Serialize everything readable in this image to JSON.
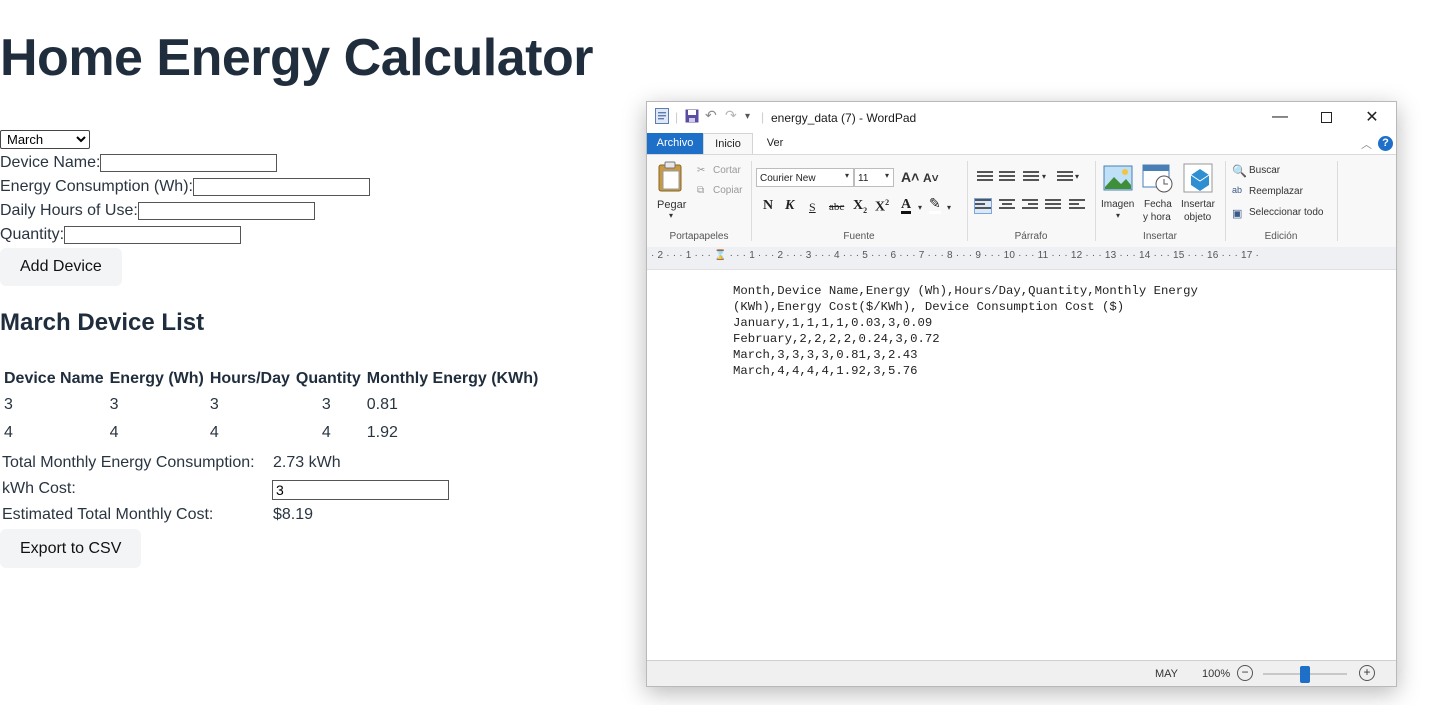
{
  "app": {
    "title": "Home Energy Calculator",
    "month_selected": "March",
    "form": {
      "device_name_label": "Device Name:",
      "energy_label": "Energy Consumption (Wh):",
      "hours_label": "Daily Hours of Use:",
      "quantity_label": "Quantity:",
      "device_name_value": "",
      "energy_value": "",
      "hours_value": "",
      "quantity_value": ""
    },
    "add_button": "Add Device",
    "list_title": "March Device List",
    "table": {
      "headers": [
        "Device Name",
        "Energy (Wh)",
        "Hours/Day",
        "Quantity",
        "Monthly Energy (KWh)"
      ],
      "rows": [
        [
          "3",
          "3",
          "3",
          "3",
          "0.81"
        ],
        [
          "4",
          "4",
          "4",
          "4",
          "1.92"
        ]
      ]
    },
    "summary": {
      "total_label": "Total Monthly Energy Consumption:",
      "total_value": "2.73 kWh",
      "cost_label": "kWh Cost:",
      "cost_value": "3",
      "estimate_label": "Estimated Total Monthly Cost:",
      "estimate_value": "$8.19"
    },
    "export_button": "Export to CSV"
  },
  "wordpad": {
    "title": "energy_data (7) - WordPad",
    "tabs": [
      "Archivo",
      "Inicio",
      "Ver"
    ],
    "clipboard": {
      "paste": "Pegar",
      "cut": "Cortar",
      "copy": "Copiar",
      "group": "Portapapeles"
    },
    "font": {
      "name": "Courier New",
      "size": "11",
      "group": "Fuente"
    },
    "paragraph_group": "Párrafo",
    "insert": {
      "image": "Imagen",
      "datetime_1": "Fecha",
      "datetime_2": "y hora",
      "object_1": "Insertar",
      "object_2": "objeto",
      "group": "Insertar"
    },
    "edit": {
      "find": "Buscar",
      "replace": "Reemplazar",
      "select_all": "Seleccionar todo",
      "group": "Edición"
    },
    "ruler": "· 2 · · · 1 · · · ⌛ · · · 1 · · · 2 · · · 3 · · · 4 · · · 5 · · · 6 · · · 7 · · · 8 · · · 9 · · · 10 · · · 11 · · · 12 · · · 13 · · · 14 · · · 15 · · · 16 · · · 17 ·",
    "document_lines": [
      "Month,Device Name,Energy (Wh),Hours/Day,Quantity,Monthly Energy",
      "(KWh),Energy Cost($/KWh), Device Consumption Cost ($)",
      "January,1,1,1,1,0.03,3,0.09",
      "February,2,2,2,2,0.24,3,0.72",
      "March,3,3,3,3,0.81,3,2.43",
      "March,4,4,4,4,1.92,3,5.76"
    ],
    "status": {
      "caps": "MAY",
      "zoom": "100%",
      "zoom_level": 1.0
    }
  },
  "colors": {
    "heading": "#1f2d3d",
    "accent": "#1e6fc8",
    "button_bg": "#f3f4f6"
  }
}
